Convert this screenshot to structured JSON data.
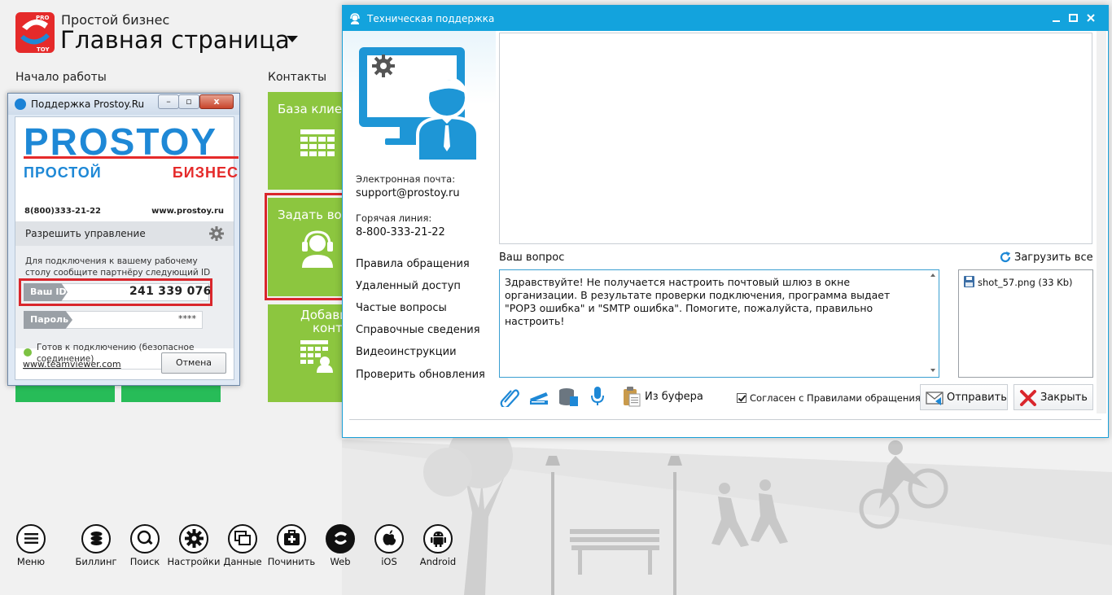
{
  "header": {
    "subtitle": "Простой бизнес",
    "title": "Главная страница"
  },
  "sections": {
    "start": "Начало работы",
    "contacts": "Контакты"
  },
  "tiles": {
    "clients": "База клиент",
    "ask": "Задать вопр",
    "add_line1": "Добави",
    "add_line2": "конта"
  },
  "teamviewer": {
    "window_title": "Поддержка Prostoy.Ru",
    "brand": "PROSTOY",
    "brand_ru_left": "ПРОСТОЙ",
    "brand_ru_right": "БИЗНЕС",
    "phone": "8(800)333-21-22",
    "site": "www.prostoy.ru",
    "panel_title": "Разрешить управление",
    "hint": "Для подключения к вашему рабочему столу сообщите партнёру следующий ID",
    "id_label": "Ваш ID",
    "id_value": "241 339 076",
    "password_label": "Пароль",
    "password_value": "****",
    "status": "Готов к подключению (безопасное соединение)",
    "link": "www.teamviewer.com",
    "cancel": "Отмена"
  },
  "dialog": {
    "title": "Техническая поддержка",
    "email_label": "Электронная почта:",
    "email_value": "support@prostoy.ru",
    "hotline_label": "Горячая линия:",
    "hotline_value": "8-800-333-21-22",
    "nav": [
      "Правила обращения",
      "Удаленный доступ",
      "Частые вопросы",
      "Справочные сведения",
      "Видеоинструкции",
      "Проверить обновления"
    ],
    "question_label": "Ваш вопрос",
    "upload_all": "Загрузить все",
    "question_text": "Здравствуйте! Не получается настроить почтовый шлюз в окне организации. В результате проверки подключения, программа выдает \"POP3 ошибка\" и \"SMTP ошибка\". Помогите, пожалуйста, правильно настроить!",
    "attachment": "shot_57.png (33 Kb)",
    "from_buffer": "Из буфера",
    "agree": "Согласен с Правилами обращения",
    "agree_checked": true,
    "send": "Отправить",
    "close": "Закрыть"
  },
  "dock": [
    {
      "label": "Меню",
      "icon": "menu-icon"
    },
    {
      "label": "Биллинг",
      "icon": "billing-icon"
    },
    {
      "label": "Поиск",
      "icon": "search-icon"
    },
    {
      "label": "Настройки",
      "icon": "gear-icon"
    },
    {
      "label": "Данные",
      "icon": "data-icon"
    },
    {
      "label": "Починить",
      "icon": "repair-icon"
    },
    {
      "label": "Web",
      "icon": "web-icon"
    },
    {
      "label": "iOS",
      "icon": "apple-icon"
    },
    {
      "label": "Android",
      "icon": "android-icon"
    }
  ],
  "colors": {
    "tile_green": "#8cc63f",
    "strip_green": "#27bc58",
    "dialog_blue": "#13a3dd",
    "highlight_red": "#d9262c",
    "brand_blue": "#1e88d6",
    "brand_red": "#e52a2a"
  }
}
